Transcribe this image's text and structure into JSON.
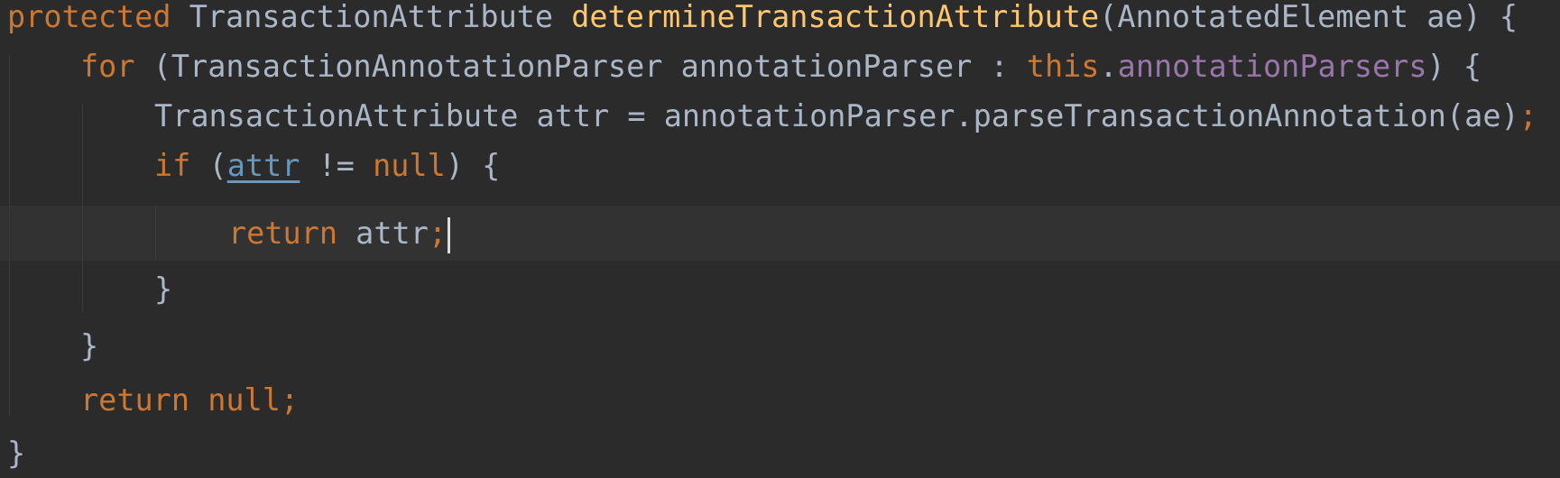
{
  "code": {
    "line1": {
      "kw_protected": "protected",
      "type1": " TransactionAttribute ",
      "method_name": "determineTransactionAttribute",
      "params": "(AnnotatedElement ae) {"
    },
    "line2": {
      "kw_for": "for",
      "mid": " (TransactionAnnotationParser annotationParser : ",
      "kw_this": "this",
      "dot": ".",
      "field": "annotationParsers",
      "end": ") {"
    },
    "line3": {
      "stmt": "TransactionAttribute attr = annotationParser.parseTransactionAnnotation(ae)",
      "semicolon": ";"
    },
    "line4": {
      "kw_if": "if",
      "open": " (",
      "var": "attr",
      "op": " != ",
      "kw_null": "null",
      "end": ") {"
    },
    "line5": {
      "kw_return": "return",
      "rest": " attr",
      "semicolon": ";"
    },
    "line6": {
      "brace": "}"
    },
    "line7": {
      "brace": "}"
    },
    "line8": {
      "kw_return": "return",
      "space": " ",
      "kw_null": "null",
      "semicolon": ";"
    },
    "line9": {
      "brace": "}"
    }
  },
  "colors": {
    "background": "#2b2b2b",
    "current_line": "#323232",
    "default_text": "#a9b7c6",
    "keyword": "#cc7832",
    "method": "#ffc66d",
    "field": "#9876aa",
    "variable_reference": "#6897bb"
  }
}
